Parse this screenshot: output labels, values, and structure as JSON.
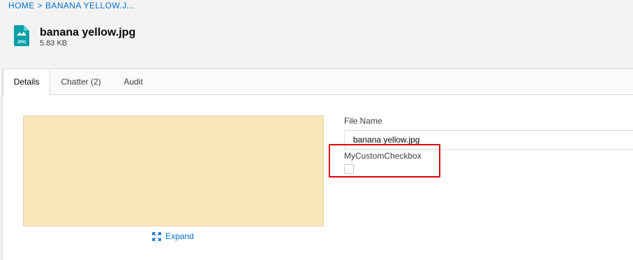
{
  "breadcrumb": {
    "home": "HOME",
    "separator": ">",
    "current": "BANANA YELLOW.J..."
  },
  "header": {
    "icon": "jpg-file-icon",
    "icon_label": "JPG",
    "title": "banana yellow.jpg",
    "size": "5.83 KB"
  },
  "tabs": [
    {
      "label": "Details",
      "active": true
    },
    {
      "label": "Chatter (2)",
      "active": false
    },
    {
      "label": "Audit",
      "active": false
    }
  ],
  "preview": {
    "color": "#fae5bb",
    "expand_label": "Expand",
    "expand_icon": "expand-icon"
  },
  "fields": {
    "file_name_label": "File Name",
    "file_name_value": "banana yellow.jpg",
    "checkbox_label": "MyCustomCheckbox",
    "checkbox_checked": false
  },
  "colors": {
    "link": "#0070d2",
    "highlight": "#e0000f",
    "icon_teal": "#07a0a8"
  }
}
